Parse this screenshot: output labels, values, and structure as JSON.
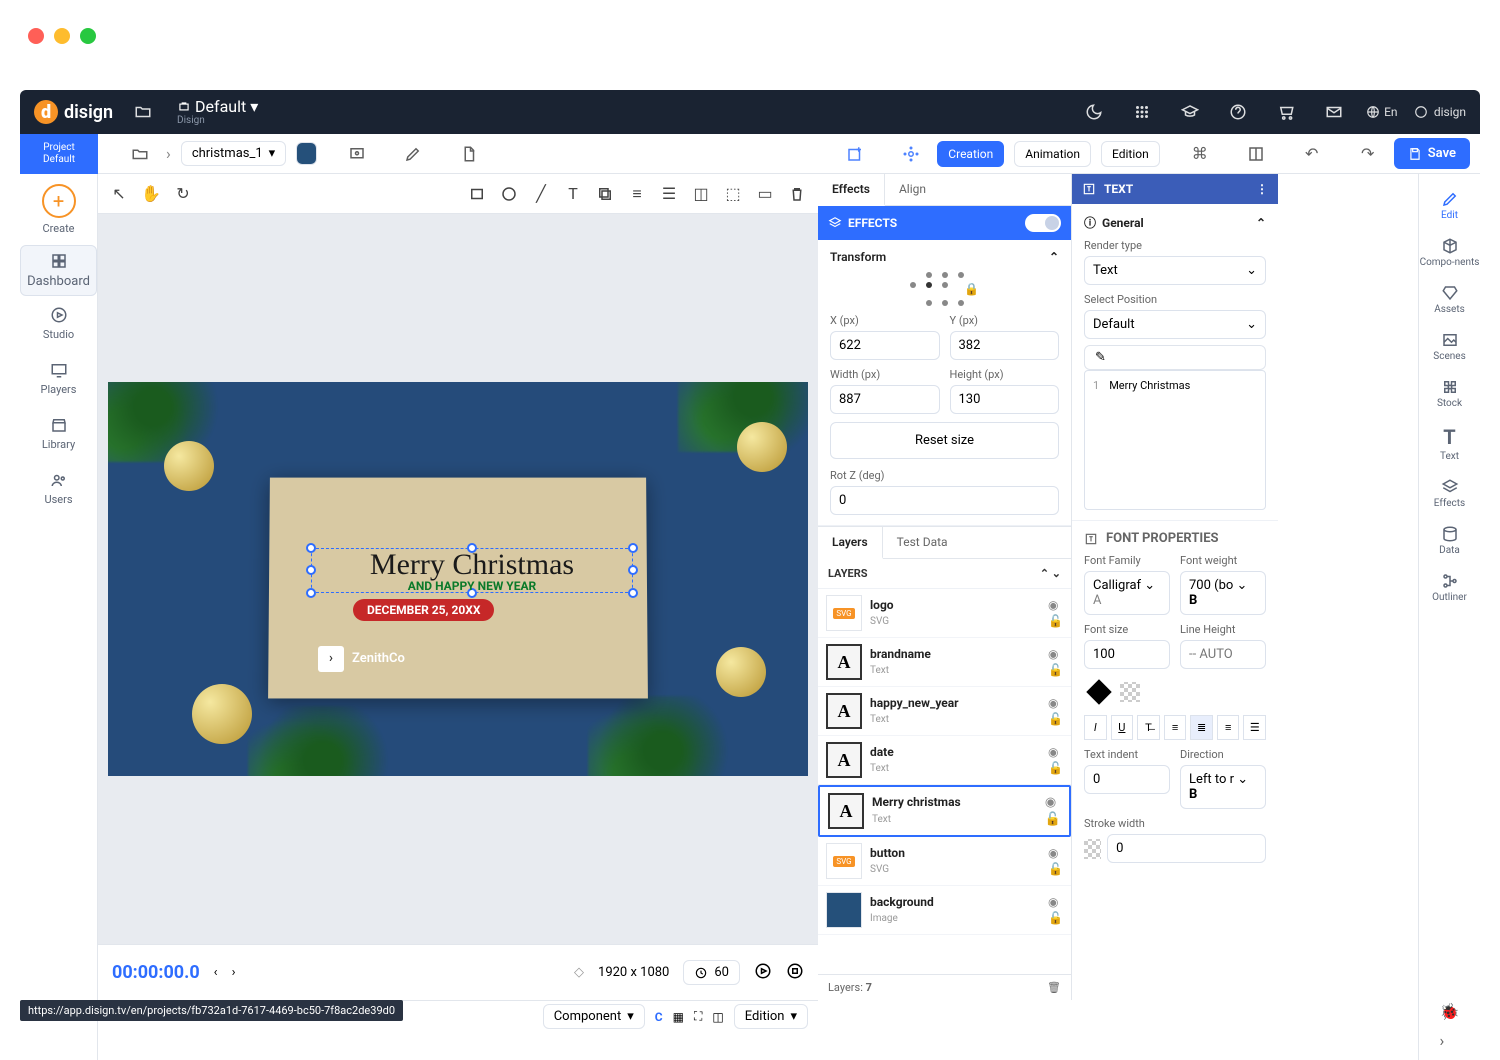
{
  "header": {
    "brand": "disign",
    "default_label": "Default",
    "default_sub": "Disign",
    "lang": "En",
    "user": "disign"
  },
  "toolbar": {
    "project": "Project",
    "project_sub": "Default",
    "breadcrumb": "christmas_1",
    "creation": "Creation",
    "animation": "Animation",
    "edition": "Edition",
    "save": "Save"
  },
  "leftrail": {
    "create": "Create",
    "dashboard": "Dashboard",
    "studio": "Studio",
    "players": "Players",
    "library": "Library",
    "users": "Users"
  },
  "rightrail": {
    "edit": "Edit",
    "components": "Compo-nents",
    "assets": "Assets",
    "scenes": "Scenes",
    "stock": "Stock",
    "text": "Text",
    "effects": "Effects",
    "data": "Data",
    "outliner": "Outliner"
  },
  "canvas": {
    "merry": "Merry Christmas",
    "hny": "AND HAPPY NEW YEAR",
    "date": "DECEMBER 25, 20XX",
    "brand": "ZenithCo"
  },
  "timeline": {
    "time": "00:00:00.0",
    "dims": "1920 x 1080",
    "dur": "60",
    "component": "Component",
    "edition": "Edition"
  },
  "midpanel": {
    "tabs": {
      "effects": "Effects",
      "align": "Align"
    },
    "effects_hdr": "EFFECTS",
    "transform": "Transform",
    "x_lbl": "X (px)",
    "x_val": "622",
    "y_lbl": "Y (px)",
    "y_val": "382",
    "w_lbl": "Width (px)",
    "w_val": "887",
    "h_lbl": "Height (px)",
    "h_val": "130",
    "reset": "Reset size",
    "rotz_lbl": "Rot Z (deg)",
    "rotz_val": "0",
    "layer_tabs": {
      "layers": "Layers",
      "test": "Test Data"
    },
    "layers_hdr": "LAYERS",
    "layers": [
      {
        "name": "logo",
        "type": "SVG",
        "th": "svg"
      },
      {
        "name": "brandname",
        "type": "Text",
        "th": "txt"
      },
      {
        "name": "happy_new_year",
        "type": "Text",
        "th": "txt"
      },
      {
        "name": "date",
        "type": "Text",
        "th": "txt"
      },
      {
        "name": "Merry christmas",
        "type": "Text",
        "th": "txt",
        "sel": true
      },
      {
        "name": "button",
        "type": "SVG",
        "th": "svg"
      },
      {
        "name": "background",
        "type": "Image",
        "th": "img"
      }
    ],
    "layers_count_lbl": "Layers:",
    "layers_count": "7"
  },
  "rpanel": {
    "title": "TEXT",
    "general": "General",
    "render_lbl": "Render type",
    "render_val": "Text",
    "selpos_lbl": "Select Position",
    "selpos_val": "Default",
    "code": "Merry Christmas",
    "font_props": "FONT PROPERTIES",
    "ff_lbl": "Font Family",
    "ff_val": "Calligraf",
    "fw_lbl": "Font weight",
    "fw_val": "700 (bo",
    "fs_lbl": "Font size",
    "fs_val": "100",
    "lh_lbl": "Line Height",
    "lh_ph": "-- AUTO",
    "ti_lbl": "Text indent",
    "ti_val": "0",
    "dir_lbl": "Direction",
    "dir_val": "Left to r",
    "stroke_lbl": "Stroke width",
    "stroke_val": "0"
  },
  "url": "https://app.disign.tv/en/projects/fb732a1d-7617-4469-bc50-7f8ac2de39d0"
}
